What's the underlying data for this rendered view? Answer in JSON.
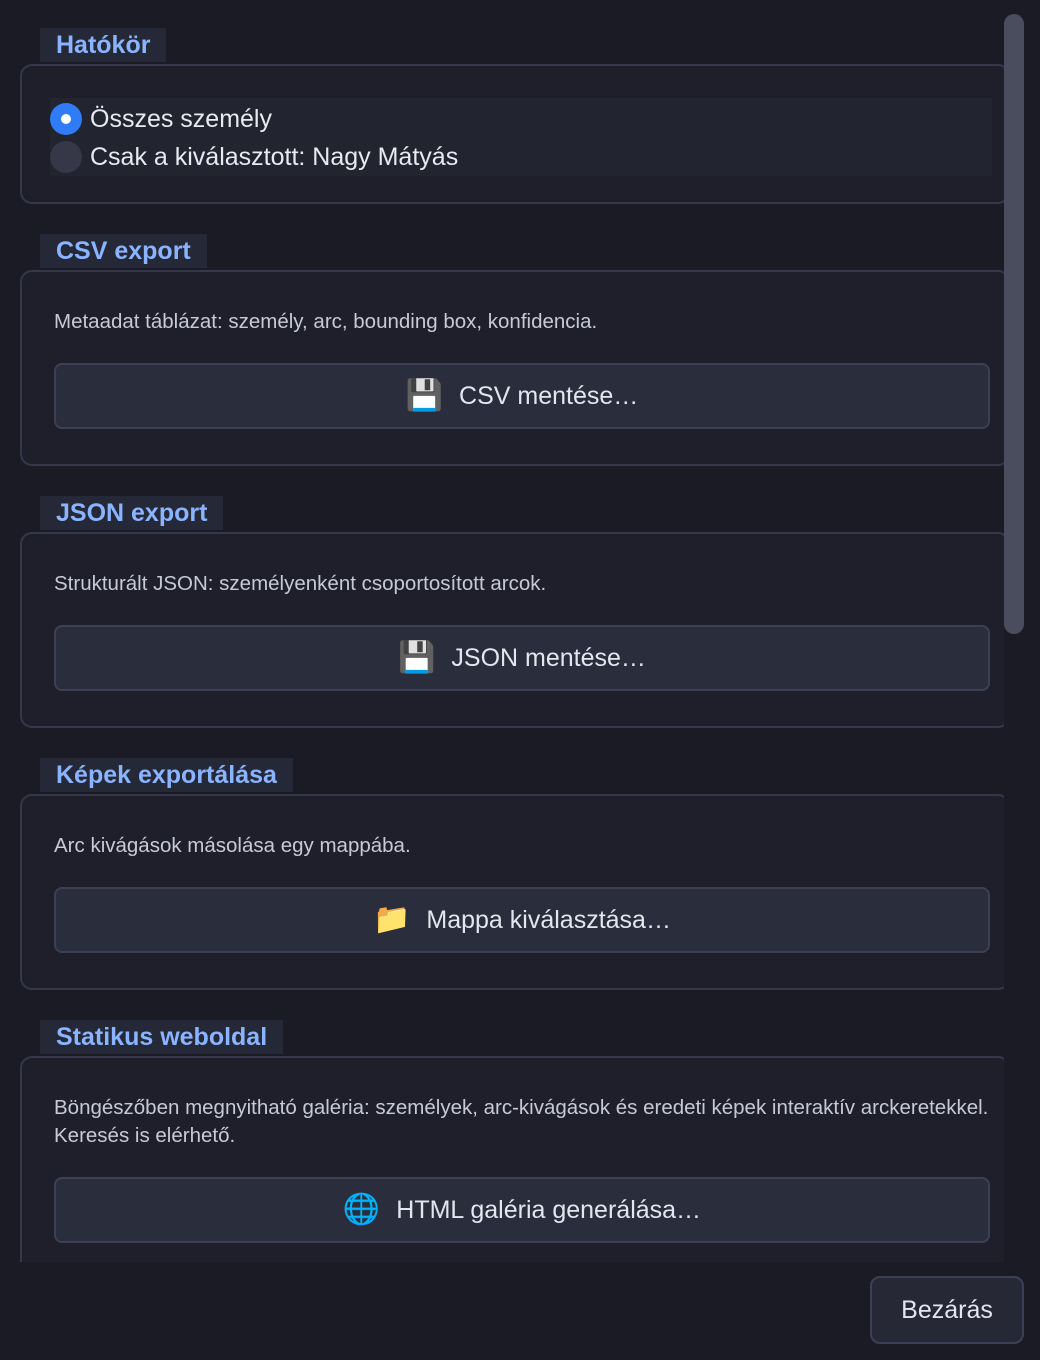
{
  "scope": {
    "title": "Hatókör",
    "options": [
      {
        "label": "Összes személy",
        "checked": true
      },
      {
        "label": "Csak a kiválasztott: Nagy Mátyás",
        "checked": false
      }
    ]
  },
  "csv": {
    "title": "CSV export",
    "description": "Metaadat táblázat: személy, arc, bounding box, konfidencia.",
    "button_icon": "💾",
    "button_label": "CSV mentése…"
  },
  "json": {
    "title": "JSON export",
    "description": "Strukturált JSON: személyenként csoportosított arcok.",
    "button_icon": "💾",
    "button_label": "JSON mentése…"
  },
  "images": {
    "title": "Képek exportálása",
    "description": "Arc kivágások másolása egy mappába.",
    "button_icon": "📁",
    "button_label": "Mappa kiválasztása…"
  },
  "website": {
    "title": "Statikus weboldal",
    "description": "Böngészőben megnyitható galéria: személyek, arc-kivágások és eredeti képek interaktív arckeretekkel. Keresés is elérhető.",
    "button_icon": "🌐",
    "button_label": "HTML galéria generálása…"
  },
  "footer": {
    "close_label": "Bezárás"
  },
  "colors": {
    "accent": "#8ab4ff",
    "radio_on": "#2f7cf6",
    "background": "#1b1b26"
  }
}
